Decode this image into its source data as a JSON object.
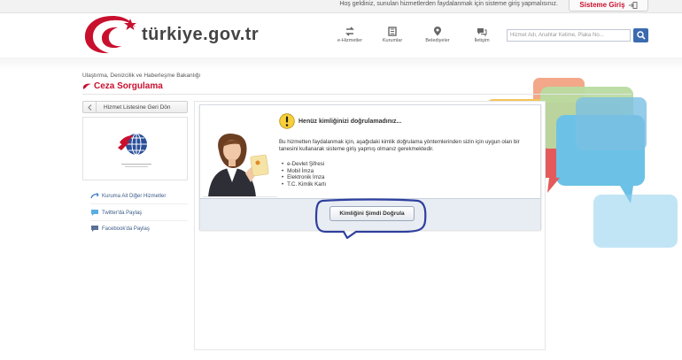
{
  "topbar": {
    "welcome": "Hoş geldiniz, sunulan hizmetlerden faydalanmak için sisteme giriş yapmalısınız.",
    "login_label": "Sisteme Giriş"
  },
  "header": {
    "logo_text": "türkiye.gov.tr",
    "nav": [
      {
        "label": "e-Hizmetler",
        "icon": "e-services-icon"
      },
      {
        "label": "Kurumlar",
        "icon": "institutions-icon"
      },
      {
        "label": "Belediyeler",
        "icon": "location-pin-icon"
      },
      {
        "label": "İletişim",
        "icon": "contact-icon"
      }
    ],
    "search_placeholder": "Hizmet Adı, Anahtar Kelime, Plaka No..."
  },
  "page": {
    "ministry": "Ulaştırma, Denizcilik ve Haberleşme Bakanlığı",
    "title": "Ceza Sorgulama"
  },
  "sidebar": {
    "back_label": "Hizmet Listesine Geri Dön",
    "links": [
      {
        "label": "Kuruma Ait Diğer Hizmetler"
      },
      {
        "label": "Twitter'da Paylaş"
      },
      {
        "label": "Facebook'da Paylaş"
      }
    ]
  },
  "content": {
    "warning_title": "Henüz kimliğinizi doğrulamadınız...",
    "description": "Bu hizmetten faydalanmak için, aşağıdaki kimlik doğrulama yöntemlerinden sizin için uygun olan bir tanesini kullanarak sisteme giriş yapmış olmanız gerekmektedir.",
    "methods": [
      "e-Devlet Şifresi",
      "Mobil İmza",
      "Elektronik İmza",
      "T.C. Kimlik Kartı"
    ],
    "verify_label": "Kimliğini Şimdi Doğrula"
  },
  "colors": {
    "accent": "#c8102e",
    "link": "#3b5a86",
    "highlight_ring": "#2f3f9e"
  }
}
